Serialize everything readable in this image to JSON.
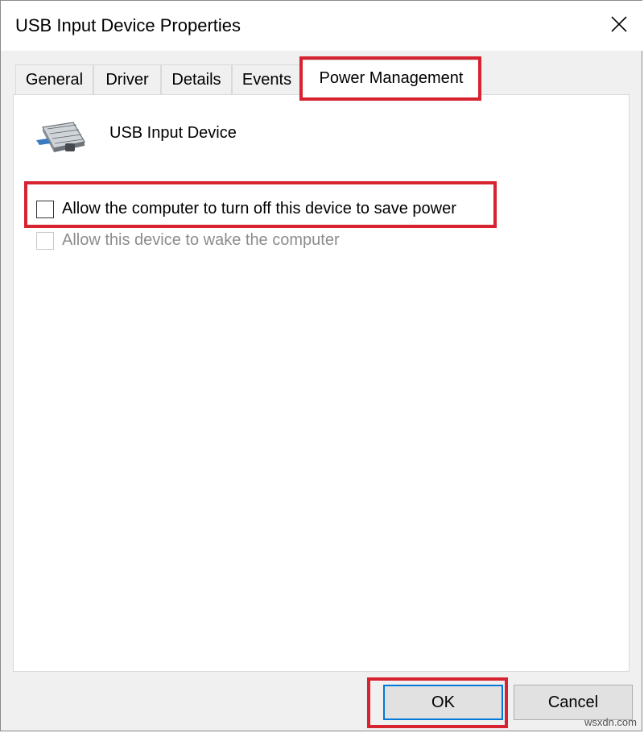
{
  "window": {
    "title": "USB Input Device Properties",
    "close_glyph": "✕"
  },
  "tabs": [
    {
      "label": "General"
    },
    {
      "label": "Driver"
    },
    {
      "label": "Details"
    },
    {
      "label": "Events"
    },
    {
      "label": "Power Management",
      "active": true
    }
  ],
  "device": {
    "name": "USB Input Device",
    "icon": "usb-keyboard-icon"
  },
  "options": [
    {
      "label": "Allow the computer to turn off this device to save power",
      "checked": false,
      "enabled": true
    },
    {
      "label": "Allow this device to wake the computer",
      "checked": false,
      "enabled": false
    }
  ],
  "buttons": {
    "ok_label": "OK",
    "cancel_label": "Cancel"
  },
  "colors": {
    "highlight": "#d6232f",
    "default_button_border": "#0078d7"
  },
  "watermark": "wsxdn.com"
}
